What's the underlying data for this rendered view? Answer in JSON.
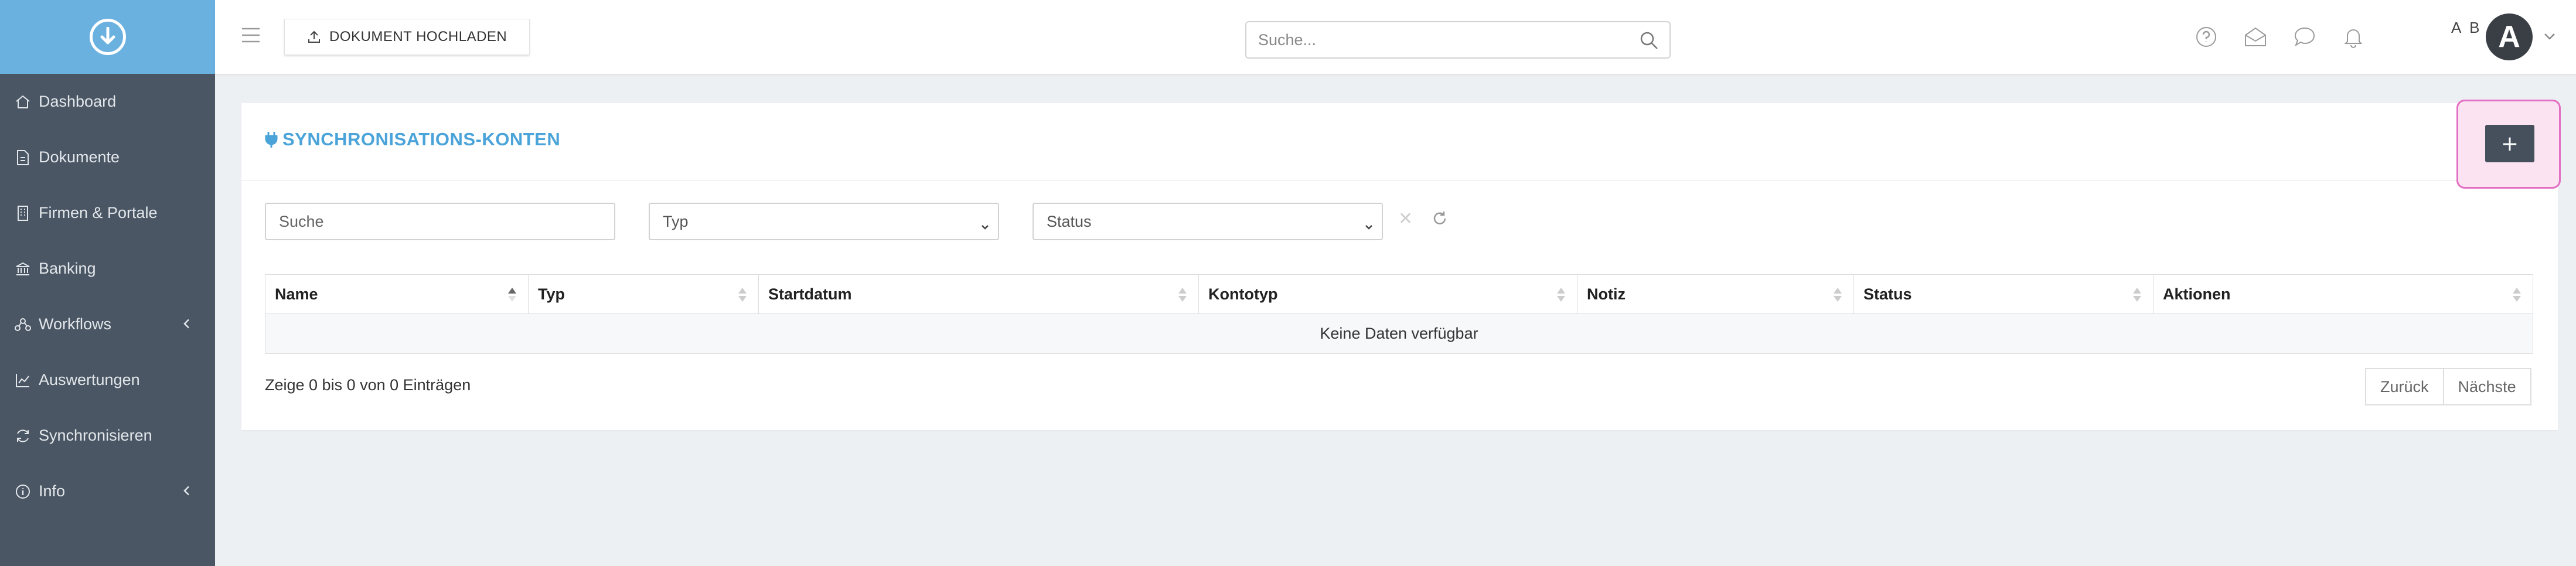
{
  "sidebar": {
    "items": [
      {
        "label": "Dashboard",
        "icon": "home-icon"
      },
      {
        "label": "Dokumente",
        "icon": "document-icon"
      },
      {
        "label": "Firmen & Portale",
        "icon": "building-icon"
      },
      {
        "label": "Banking",
        "icon": "bank-icon"
      },
      {
        "label": "Workflows",
        "icon": "workflow-icon",
        "expandable": true
      },
      {
        "label": "Auswertungen",
        "icon": "chart-icon"
      },
      {
        "label": "Synchronisieren",
        "icon": "sync-icon"
      },
      {
        "label": "Info",
        "icon": "info-icon",
        "expandable": true
      }
    ]
  },
  "header": {
    "upload_label": "DOKUMENT HOCHLADEN",
    "search_placeholder": "Suche...",
    "user_initials": "A B",
    "avatar_letter": "A"
  },
  "page": {
    "title": "SYNCHRONISATIONS-KONTEN",
    "add_label": "+"
  },
  "filters": {
    "search_placeholder": "Suche",
    "type_placeholder": "Typ",
    "status_placeholder": "Status",
    "clear_symbol": "✕"
  },
  "table": {
    "columns": [
      "Name",
      "Typ",
      "Startdatum",
      "Kontotyp",
      "Notiz",
      "Status",
      "Aktionen"
    ],
    "empty_text": "Keine Daten verfügbar",
    "info": "Zeige 0 bis 0 von 0 Einträgen",
    "prev_label": "Zurück",
    "next_label": "Nächste"
  },
  "colors": {
    "sidebar_bg": "#4a5664",
    "logo_bg": "#6bb1e0",
    "accent": "#4aa3d9",
    "add_button": "#46505d",
    "highlight": "#e36fc4"
  }
}
